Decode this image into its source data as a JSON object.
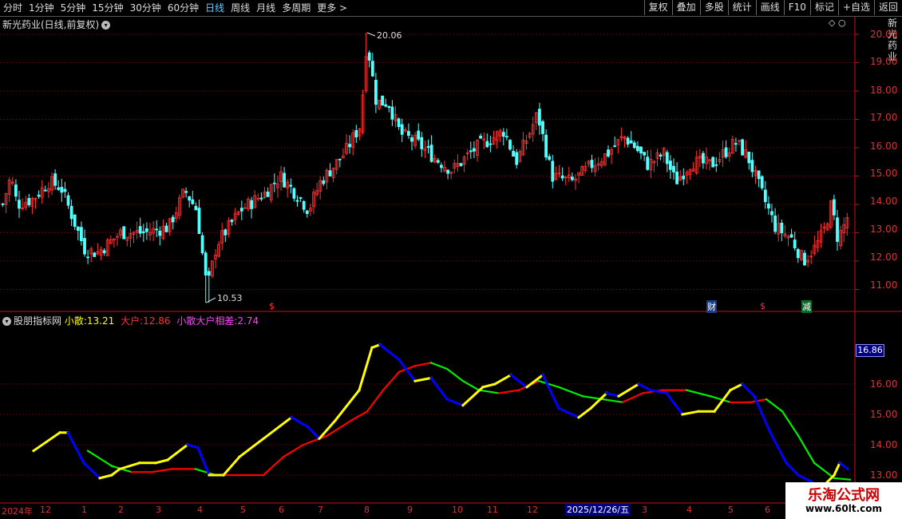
{
  "toolbar": {
    "periods": [
      "分时",
      "1分钟",
      "5分钟",
      "15分钟",
      "30分钟",
      "60分钟",
      "日线",
      "周线",
      "月线",
      "多周期",
      "更多"
    ],
    "active_period": "日线",
    "buttons": [
      "复权",
      "叠加",
      "多股",
      "统计",
      "画线",
      "F10",
      "标记",
      "+自选",
      "返回"
    ]
  },
  "stock": {
    "title": "新光药业(日线,前复权)",
    "high_label": "20.06",
    "low_label": "10.53"
  },
  "indicator": {
    "name": "股朋指标网",
    "s1_label": "小散:",
    "s1_value": "13.21",
    "s2_label": "大户:",
    "s2_value": "12.86",
    "s3_label": "小散大户相差:",
    "s3_value": "2.74"
  },
  "price_axis": [
    "20.00",
    "19.00",
    "18.00",
    "17.00",
    "16.00",
    "15.00",
    "14.00",
    "13.00",
    "12.00",
    "11.00"
  ],
  "indicator_axis": [
    "16.86",
    "16.00",
    "15.00",
    "14.00",
    "13.00"
  ],
  "time_axis": {
    "labels": [
      "2024年",
      "12",
      "1",
      "2",
      "3",
      "4",
      "5",
      "6",
      "7",
      "8",
      "9",
      "10",
      "11",
      "12",
      "3",
      "4",
      "5",
      "6"
    ],
    "highlight": "2025/12/26/五"
  },
  "markers": {
    "s1": "$",
    "cai": "财",
    "s2": "$",
    "jian": "减"
  },
  "right_edge_text": "新光药业",
  "watermark": {
    "line1": "乐淘公式网",
    "line2": "www.60lt.com"
  },
  "colors": {
    "up": "#ff3232",
    "down": "#54ffff",
    "axis": "#c81010",
    "yellow": "#ffff00",
    "red": "#ff0000",
    "blue": "#0000ff",
    "green": "#00ee00"
  },
  "chart_data": {
    "type": "candlestick",
    "price_range": [
      10.2,
      20.6
    ],
    "high": 20.06,
    "low": 10.53,
    "indicator_range": [
      12.8,
      17.8
    ]
  }
}
